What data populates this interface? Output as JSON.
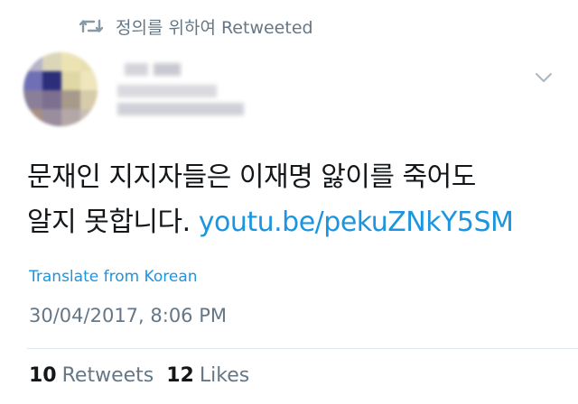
{
  "retweet": {
    "icon": "retweet-icon",
    "text": "정의를 위하여 Retweeted"
  },
  "author": {
    "avatar": "blurred-avatar"
  },
  "menu": {
    "icon": "chevron-down-icon"
  },
  "tweet": {
    "text_line1": "문재인 지지자들은 이재명 앓이를 죽어도",
    "text_line2": "알지 못합니다.",
    "link": "youtu.be/pekuZNkY5SM"
  },
  "translate_label": "Translate from Korean",
  "timestamp": "30/04/2017, 8:06 PM",
  "stats": {
    "retweets_count": "10",
    "retweets_label": "Retweets",
    "likes_count": "12",
    "likes_label": "Likes"
  },
  "colors": {
    "link": "#1b95e0",
    "secondary_text": "#657786",
    "primary_text": "#14171a",
    "divider": "#e1e8ed"
  }
}
